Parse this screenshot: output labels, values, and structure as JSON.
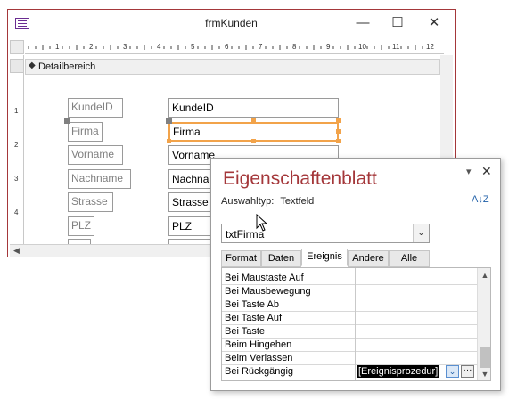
{
  "window": {
    "title": "frmKunden",
    "minimize_glyph": "—",
    "maximize_glyph": "☐",
    "close_glyph": "✕",
    "section_label": "Detailbereich",
    "ruler_numbers": [
      "1",
      "2",
      "3",
      "4",
      "5",
      "6",
      "7",
      "8",
      "9",
      "10",
      "11",
      "12"
    ],
    "vruler_numbers": [
      "1",
      "2",
      "3",
      "4"
    ]
  },
  "form": {
    "labels": [
      "KundeID",
      "Firma",
      "Vorname",
      "Nachname",
      "Strasse",
      "PLZ"
    ],
    "textboxes": [
      "KundeID",
      "Firma",
      "Vorname",
      "Nachna",
      "Strasse",
      "PLZ"
    ]
  },
  "property_sheet": {
    "title": "Eigenschaftenblatt",
    "selection_type_label": "Auswahltyp:",
    "selection_type_value": "Textfeld",
    "sort_icon": "A↓Z",
    "object_combo_value": "txtFirma",
    "pin_glyph": "▾",
    "close_glyph": "✕",
    "tabs": [
      "Format",
      "Daten",
      "Ereignis",
      "Andere",
      "Alle"
    ],
    "active_tab": "Ereignis",
    "properties": [
      "Bei Maustaste Auf",
      "Bei Mausbewegung",
      "Bei Taste Ab",
      "Bei Taste Auf",
      "Bei Taste",
      "Beim Hingehen",
      "Beim Verlassen",
      "Bei Rückgängig"
    ],
    "selected_value": "[Ereignisprozedur]",
    "build_glyph": "···",
    "dropdown_glyph": "⌄"
  },
  "colors": {
    "accent": "#a4373a",
    "selection_orange": "#f2a34a"
  }
}
